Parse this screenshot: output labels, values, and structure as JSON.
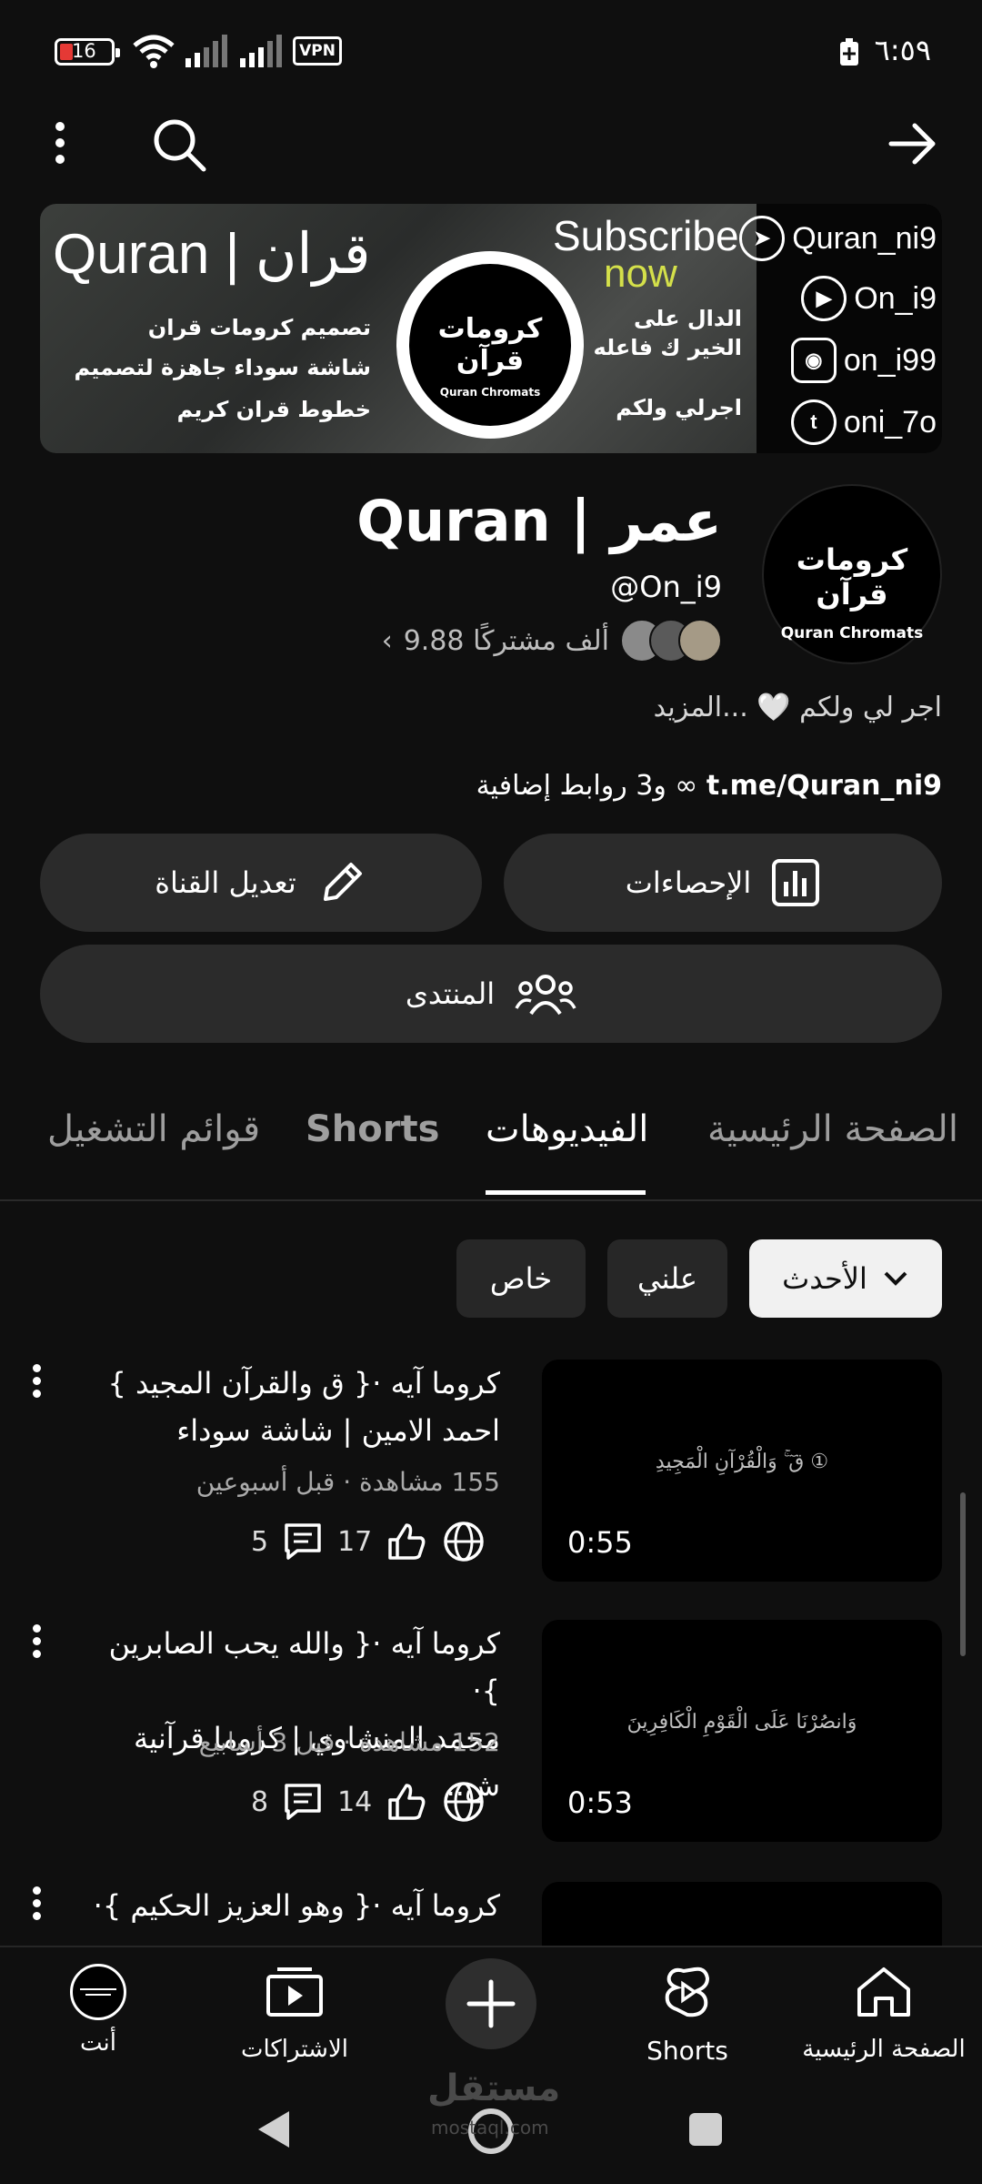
{
  "status_bar": {
    "battery": "16",
    "vpn": "VPN",
    "time": "٦:٥٩"
  },
  "banner": {
    "title": "Quran | قران",
    "features": [
      "تصميم كرومات قران",
      "شاشة سوداء جاهزة لتصميم",
      "خطوط قران كريم"
    ],
    "logo_ar": "كرومات قرآن",
    "logo_en": "Quran Chromats",
    "subscribe": "Subscribe",
    "now": "now",
    "dal_line1": "الدال على",
    "dal_line2": "الخير ك فاعله",
    "ajr": "اجرلي ولكم",
    "socials": [
      "Quran_ni9",
      "On_i9",
      "on_i99",
      "oni_7o"
    ]
  },
  "channel": {
    "avatar_ar": "كرومات قرآن",
    "avatar_en": "Quran Chromats",
    "name": "Quran | عمر",
    "handle": "@On_i9",
    "subscribers": "9.88 ألف مشتركًا",
    "description": "اجر لي ولكم 🤍 ...المزيد",
    "link": "t.me/Quran_ni9",
    "more_links": "و3 روابط إضافية"
  },
  "actions": {
    "stats": "الإحصاءات",
    "edit": "تعديل القناة",
    "community": "المنتدى"
  },
  "tabs": [
    "الصفحة الرئيسية",
    "الفيديوهات",
    "Shorts",
    "قوائم التشغيل"
  ],
  "chips": {
    "latest": "الأحدث",
    "public": "علني",
    "private": "خاص"
  },
  "videos": [
    {
      "title_l1": "كروما آيه ·{ ق والقرآن المجيد }",
      "title_l2": "احمد الامين | شاشة سوداء",
      "meta": "155 مشاهدة · قبل أسبوعين",
      "likes": "17",
      "comments": "5",
      "duration": "0:55",
      "thumb_text": "قٓ ۚ وَالْقُرْآنِ الْمَجِيدِ ①"
    },
    {
      "title_l1": "كروما آيه ·{ والله يحب الصابرين }·",
      "title_l2": "محمد المنشاوي | كروما قرآنية ش..",
      "meta": "152 مشاهدة · قبل 3 أسابيع",
      "likes": "14",
      "comments": "8",
      "duration": "0:53",
      "thumb_text": "وَانصُرْنَا عَلَى الْقَوْمِ الْكَافِرِينَ"
    },
    {
      "title_l1": "كروما آيه ·{ وهو العزيز الحكيم }·"
    }
  ],
  "bottom_nav": {
    "home": "الصفحة الرئيسية",
    "shorts": "Shorts",
    "subscriptions": "الاشتراكات",
    "you": "أنت"
  },
  "watermark": {
    "ar": "مستقل",
    "en": "mostaql.com"
  }
}
